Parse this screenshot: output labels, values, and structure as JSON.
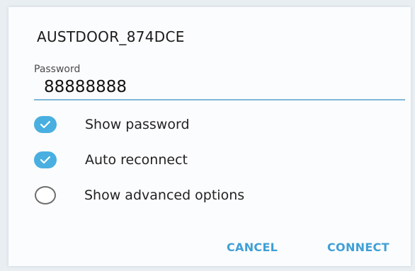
{
  "network": {
    "ssid": "AUSTDOOR_874DCE"
  },
  "password": {
    "label": "Password",
    "value": "88888888"
  },
  "options": [
    {
      "label": "Show password",
      "checked": true
    },
    {
      "label": "Auto reconnect",
      "checked": true
    },
    {
      "label": "Show advanced options",
      "checked": false
    }
  ],
  "buttons": {
    "cancel": "CANCEL",
    "connect": "CONNECT"
  },
  "colors": {
    "accent": "#49afe0",
    "button_text": "#3f9fd6",
    "underline": "#7fb7d8"
  }
}
